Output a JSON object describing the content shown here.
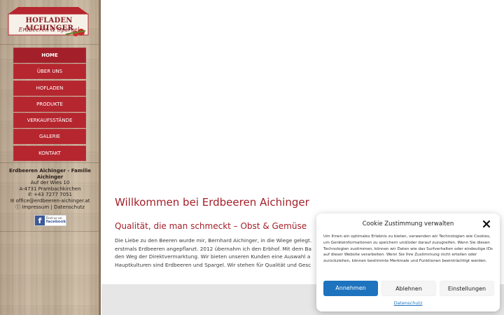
{
  "logo": {
    "title": "HOFLADEN AICHINGER",
    "subtitle": "Erdbeeren & Spargel"
  },
  "nav": {
    "items": [
      {
        "label": "HOME"
      },
      {
        "label": "ÜBER UNS"
      },
      {
        "label": "HOFLADEN"
      },
      {
        "label": "PRODUKTE"
      },
      {
        "label": "VERKAUFSSTÄNDE"
      },
      {
        "label": "GALERIE"
      },
      {
        "label": "KONTAKT"
      }
    ]
  },
  "contact": {
    "company": "Erdbeeren Aichinger - Familie Aichinger",
    "street": "Auf der Wies 10",
    "city": "A-4731 Prambachkirchen",
    "phone": " +43 7277 7051",
    "email": " office@erdbeeren-aichinger.at",
    "links": " Impressum | Datenschutz",
    "facebook_small": "Find us on",
    "facebook_big": "facebook"
  },
  "main": {
    "title": "Willkommen bei Erdbeeren Aichinger",
    "subtitle": "Qualität, die man schmeckt – Obst & Gemüse",
    "paragraph_lines": [
      "Die Liebe zu den Beeren wurde mir, Bernhard Aichinger, in die Wiege gelegt.",
      "erstmals Erdbeeren angepflanzt. 2012 übernahm ich den Erbhof. Mit dem Ba",
      "den Weg der Direktvermarktung. Wir bieten unseren Kunden eine Auswahl a",
      "Hauptkulturen sind Erdbeeren und Spargel. Wir stehen für Qualität und Gesc"
    ]
  },
  "cookie": {
    "title": "Cookie Zustimmung verwalten",
    "text": "Um Ihnen ein optimales Erlebnis zu bieten, verwenden wir Technologien wie Cookies, um Geräteinformationen zu speichern und/oder darauf zuzugreifen. Wenn Sie diesen Technologien zustimmen, können wir Daten wie das Surfverhalten oder eindeutige IDs auf dieser Website verarbeiten. Wenn Sie Ihre Zustimmung nicht erteilen oder zurückziehen, können bestimmte Merkmale und Funktionen beeinträchtigt werden.",
    "accept": "Annehmen",
    "deny": "Ablehnen",
    "settings": "Einstellungen",
    "privacy_link": "Datenschutz"
  },
  "colors": {
    "brand_red": "#b5262e",
    "heading_red": "#a3212a",
    "accept_blue": "#1e73be"
  }
}
